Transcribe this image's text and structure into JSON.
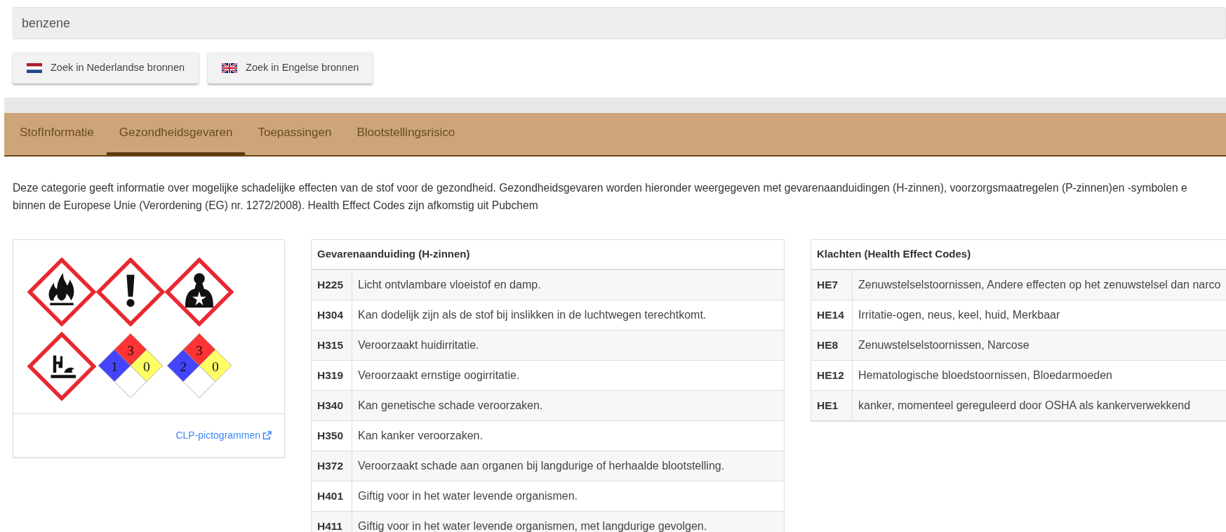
{
  "search": {
    "value": "benzene"
  },
  "source_buttons": [
    {
      "label": "Zoek in Nederlandse bronnen",
      "kind": "nl"
    },
    {
      "label": "Zoek in Engelse bronnen",
      "kind": "gb"
    }
  ],
  "tabs": [
    {
      "label": "StofInformatie",
      "selected": false
    },
    {
      "label": "Gezondheidsgevaren",
      "selected": true
    },
    {
      "label": "Toepassingen",
      "selected": false
    },
    {
      "label": "Blootstellingsrisico",
      "selected": false
    }
  ],
  "intro": [
    "Deze categorie geeft informatie over mogelijke schadelijke effecten van de stof voor de gezondheid. Gezondheidsgevaren worden hieronder weergegeven met gevarenaanduidingen (H-zinnen), voorzorgsmaatregelen (P-zinnen)en -symbolen e",
    "binnen de Europese Unie (Verordening (EG) nr. 1272/2008). Health Effect Codes zijn afkomstig uit Pubchem"
  ],
  "pictograms": [
    {
      "kind": "flammable"
    },
    {
      "kind": "irritant"
    },
    {
      "kind": "health"
    },
    {
      "kind": "environment"
    },
    {
      "kind": "nfpa",
      "fire": "3",
      "health": "1",
      "reactivity": "0"
    },
    {
      "kind": "nfpa",
      "fire": "3",
      "health": "2",
      "reactivity": "0"
    }
  ],
  "pictogram_link": "CLP-pictogrammen",
  "hazard_table": {
    "title": "Gevarenaanduiding (H-zinnen)",
    "rows": [
      {
        "code": "H225",
        "text": "Licht ontvlambare vloeistof en damp."
      },
      {
        "code": "H304",
        "text": "Kan dodelijk zijn als de stof bij inslikken in de luchtwegen terechtkomt."
      },
      {
        "code": "H315",
        "text": "Veroorzaakt huidirritatie."
      },
      {
        "code": "H319",
        "text": "Veroorzaakt ernstige oogirritatie."
      },
      {
        "code": "H340",
        "text": "Kan genetische schade veroorzaken."
      },
      {
        "code": "H350",
        "text": "Kan kanker veroorzaken."
      },
      {
        "code": "H372",
        "text": "Veroorzaakt schade aan organen bij langdurige of herhaalde blootstelling."
      },
      {
        "code": "H401",
        "text": "Giftig voor in het water levende organismen."
      },
      {
        "code": "H411",
        "text": "Giftig voor in het water levende organismen, met langdurige gevolgen."
      }
    ]
  },
  "effects_table": {
    "title": "Klachten (Health Effect Codes)",
    "rows": [
      {
        "code": "HE7",
        "text": "Zenuwstelselstoornissen, Andere effecten op het zenuwstelsel dan narco"
      },
      {
        "code": "HE14",
        "text": "Irritatie-ogen, neus, keel, huid, Merkbaar"
      },
      {
        "code": "HE8",
        "text": "Zenuwstelselstoornissen, Narcose"
      },
      {
        "code": "HE12",
        "text": "Hematologische bloedstoornissen, Bloedarmoeden"
      },
      {
        "code": "HE1",
        "text": "kanker, momenteel gereguleerd door OSHA als kankerverwekkend"
      }
    ]
  }
}
